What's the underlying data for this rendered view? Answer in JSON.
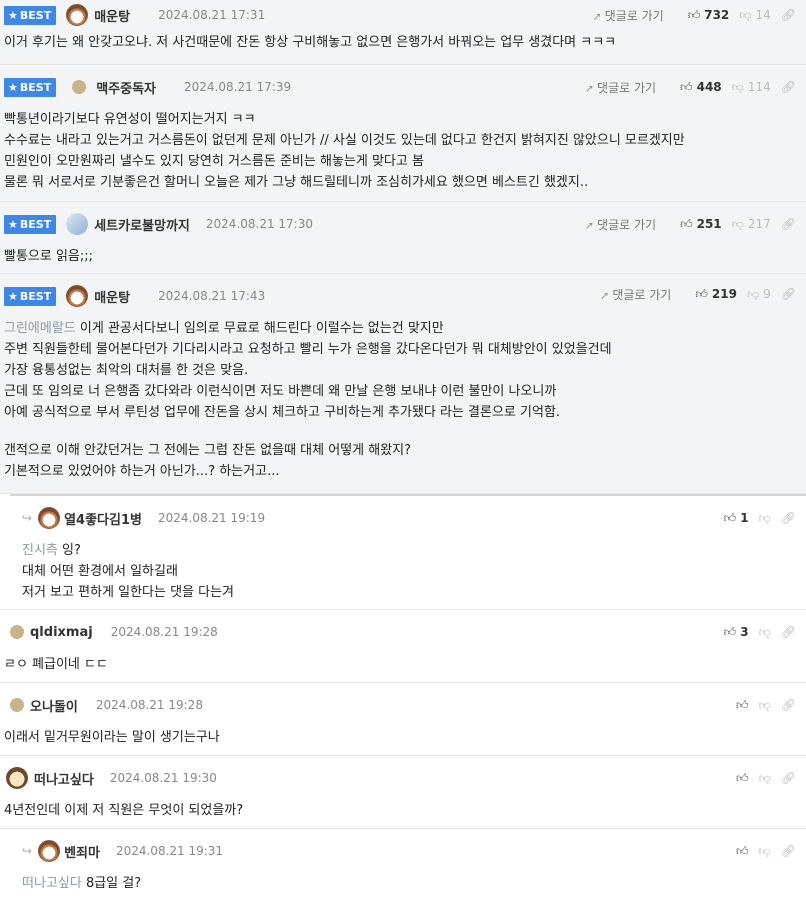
{
  "labels": {
    "best": "BEST",
    "goto": "댓글로 가기"
  },
  "best": [
    {
      "nick": "매운탕",
      "date": "2024.08.21 17:31",
      "up": "732",
      "down": "14",
      "lines": [
        "이거 후기는 왜 안갖고오냐. 저 사건때문에 잔돈 항상 구비해놓고 없으면 은행가서 바꿔오는 업무 생겼다며 ㅋㅋㅋ"
      ]
    },
    {
      "nick": "맥주중독자",
      "date": "2024.08.21 17:39",
      "up": "448",
      "down": "114",
      "lines": [
        "빡통년이라기보다 유연성이 떨어지는거지 ㅋㅋ",
        "수수료는 내라고 있는거고 거스름돈이 없던게 문제 아닌가 // 사실 이것도 있는데 없다고 한건지 밝혀지진 않았으니 모르겠지만",
        "민원인이 오만원짜리 낼수도 있지 당연히 거스름돈 준비는 해놓는게 맞다고 봄",
        "물론 뭐 서로서로 기분좋은건 할머니 오늘은 제가 그냥 해드릴테니까 조심히가세요 했으면 베스트긴 했겠지.."
      ]
    },
    {
      "nick": "세트카로불망까지",
      "date": "2024.08.21 17:30",
      "up": "251",
      "down": "217",
      "lines": [
        "빨통으로 읽음;;;"
      ]
    },
    {
      "nick": "매운탕",
      "date": "2024.08.21 17:43",
      "up": "219",
      "down": "9",
      "mention": "그린에메랄드",
      "first": " 이게 관공서다보니 임의로 무료로 해드린다 이럴수는 없는건 맞지만",
      "lines": [
        "주변 직원들한테 물어본다던가 기다리시라고 요청하고 빨리 누가 은행을 갔다온다던가 뭐 대체방안이 있었을건데",
        "가장 융통성없는 최악의 대처를 한 것은 맞음.",
        "근데 또 임의로 너 은행좀 갔다와라 이런식이면 저도 바쁜데 왜 만날 은행 보내냐 이런 불만이 나오니까",
        "아예 공식적으로 부서 루틴성 업무에 잔돈을 상시 체크하고 구비하는게 추가됐다 라는 결론으로 기억함.",
        "",
        "갠적으로 이해 안갔던거는 그 전에는 그럼 잔돈 없을때 대체 어떻게 해왔지?",
        "기본적으로 있었어야 하는거 아닌가...? 하는거고..."
      ]
    }
  ],
  "comments": [
    {
      "nick": "열4좋다김1병",
      "date": "2024.08.21 19:19",
      "up": "1",
      "mention": "진시측",
      "first": " 잉?",
      "lines": [
        "대체 어떤 환경에서 일하길래",
        "저거 보고 편하게 일한다는 댓을 다는겨"
      ]
    },
    {
      "nick": "qldixmaj",
      "date": "2024.08.21 19:28",
      "up": "3",
      "lines": [
        "ㄹㅇ 폐급이네 ㄷㄷ"
      ]
    },
    {
      "nick": "오나돌이",
      "date": "2024.08.21 19:28",
      "up": "",
      "lines": [
        "이래서 밑거무원이라는 말이 생기는구나"
      ]
    },
    {
      "nick": "떠나고싶다",
      "date": "2024.08.21 19:30",
      "up": "",
      "lines": [
        "4년전인데 이제 저 직원은 무엇이 되었을까?"
      ]
    },
    {
      "nick": "벤죄마",
      "date": "2024.08.21 19:31",
      "up": "",
      "mention": "떠나고싶다",
      "first": " 8급일 걸?",
      "lines": []
    }
  ]
}
